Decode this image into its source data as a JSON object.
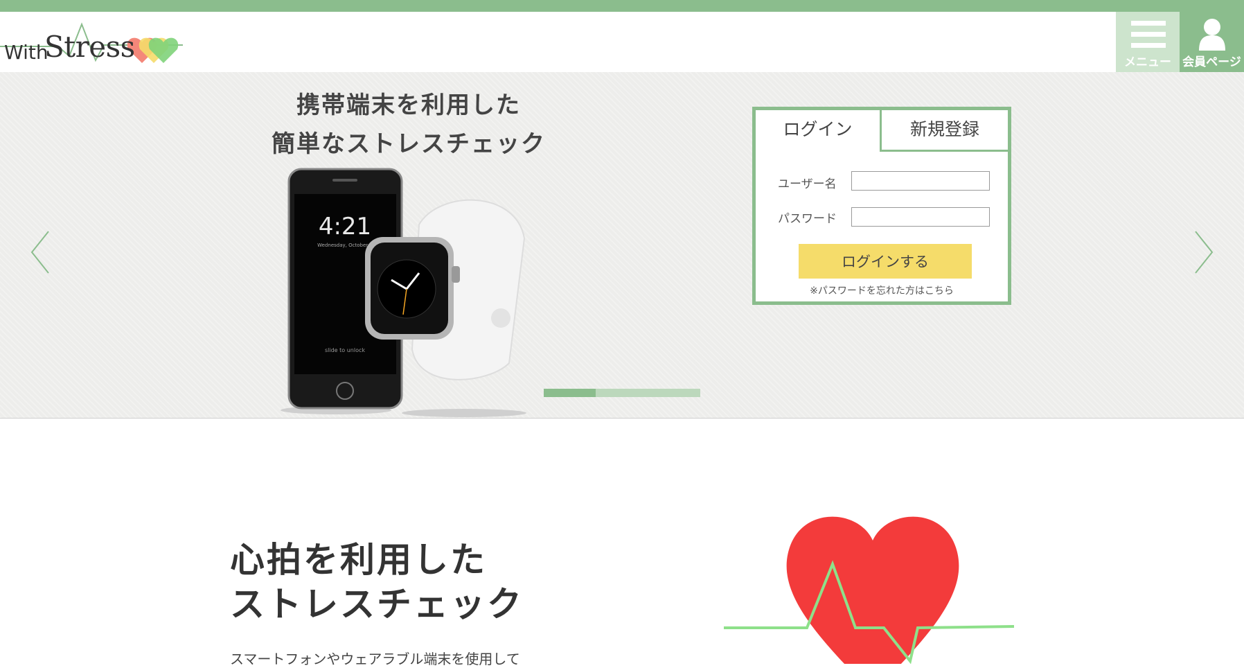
{
  "brand": {
    "logo_prefix": "With",
    "logo_main": "Stress"
  },
  "header": {
    "menu_label": "メニュー",
    "member_label": "会員ページ"
  },
  "hero": {
    "title_line1": "携帯端末を利用した",
    "title_line2": "簡単なストレスチェック",
    "phone_time": "4:21",
    "phone_date": "Wednesday, October 2",
    "phone_unlock": "slide to unlock",
    "slide_progress": 0.33
  },
  "login_box": {
    "tab_login": "ログイン",
    "tab_register": "新規登録",
    "username_label": "ユーザー名",
    "username_value": "",
    "password_label": "パスワード",
    "password_value": "",
    "submit_label": "ログインする",
    "forgot_link": "※パスワードを忘れた方はこちら"
  },
  "feature": {
    "title_line1": "心拍を利用した",
    "title_line2": "ストレスチェック",
    "text": "スマートフォンやウェアラブル端末を使用して"
  },
  "colors": {
    "accent_green": "#8bbd8d",
    "light_green": "#cde4cd",
    "button_yellow": "#f5dc6a",
    "heart_red": "#f33b3b"
  }
}
